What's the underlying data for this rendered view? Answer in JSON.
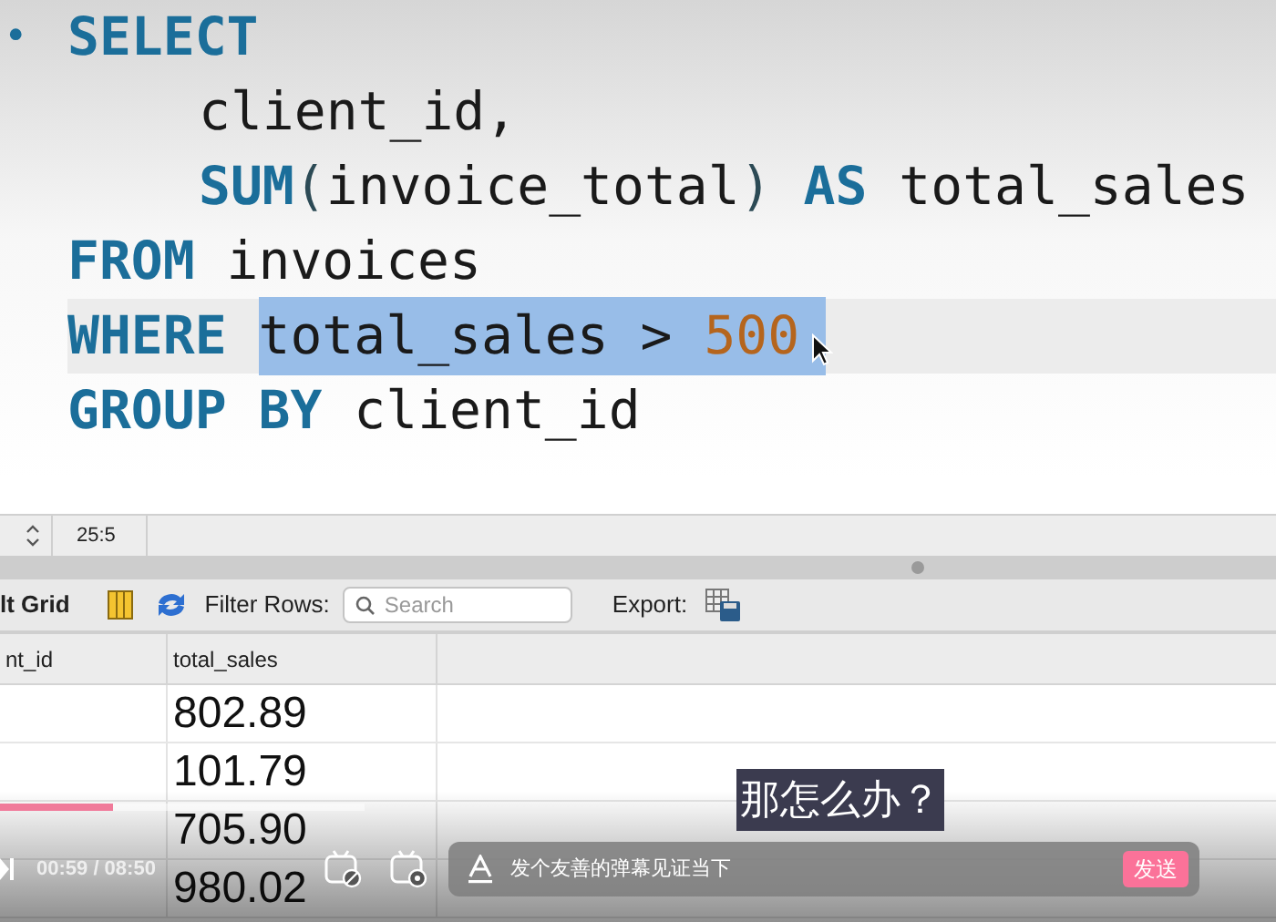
{
  "editor": {
    "lines": [
      {
        "marker": "•",
        "indented": false,
        "current": false,
        "tokens": [
          {
            "text": "SELECT",
            "kind": "keyword",
            "selected": false
          }
        ]
      },
      {
        "indented": true,
        "current": false,
        "tokens": [
          {
            "text": "client_id,",
            "kind": "ident",
            "selected": false
          }
        ]
      },
      {
        "indented": true,
        "current": false,
        "tokens": [
          {
            "text": "SUM",
            "kind": "keyword",
            "selected": false
          },
          {
            "text": "(",
            "kind": "punct",
            "selected": false
          },
          {
            "text": "invoice_total",
            "kind": "ident",
            "selected": false
          },
          {
            "text": ")",
            "kind": "punct",
            "selected": false
          },
          {
            "text": " AS",
            "kind": "keyword",
            "selected": false
          },
          {
            "text": " total_sales",
            "kind": "ident",
            "selected": false
          }
        ]
      },
      {
        "indented": false,
        "current": false,
        "tokens": [
          {
            "text": "FROM",
            "kind": "keyword",
            "selected": false
          },
          {
            "text": " invoices",
            "kind": "ident",
            "selected": false
          }
        ]
      },
      {
        "indented": false,
        "current": true,
        "tokens": [
          {
            "text": "WHERE ",
            "kind": "keyword",
            "selected": false
          },
          {
            "text": "total_sales > ",
            "kind": "ident",
            "selected": true
          },
          {
            "text": "500",
            "kind": "number",
            "selected": true
          }
        ]
      },
      {
        "indented": false,
        "current": false,
        "tokens": [
          {
            "text": "GROUP BY",
            "kind": "keyword",
            "selected": false
          },
          {
            "text": " client_id",
            "kind": "ident",
            "selected": false
          }
        ]
      }
    ]
  },
  "status_bar": {
    "position": "25:5"
  },
  "results": {
    "tab": "lt Grid",
    "filter_label": "Filter Rows:",
    "search": {
      "placeholder": "Search"
    },
    "export_label": "Export:",
    "columns": [
      "nt_id",
      "total_sales"
    ],
    "rows": [
      [
        "",
        "802.89"
      ],
      [
        "",
        "101.79"
      ],
      [
        "",
        "705.90"
      ],
      [
        "",
        "980.02"
      ]
    ]
  },
  "player": {
    "progress": {
      "level": 0.31
    },
    "time": "00:59 / 08:50",
    "danmaku": {
      "placeholder": "发个友善的弹幕见证当下"
    },
    "send_button": "发送",
    "subtitle": "那怎么办？"
  }
}
